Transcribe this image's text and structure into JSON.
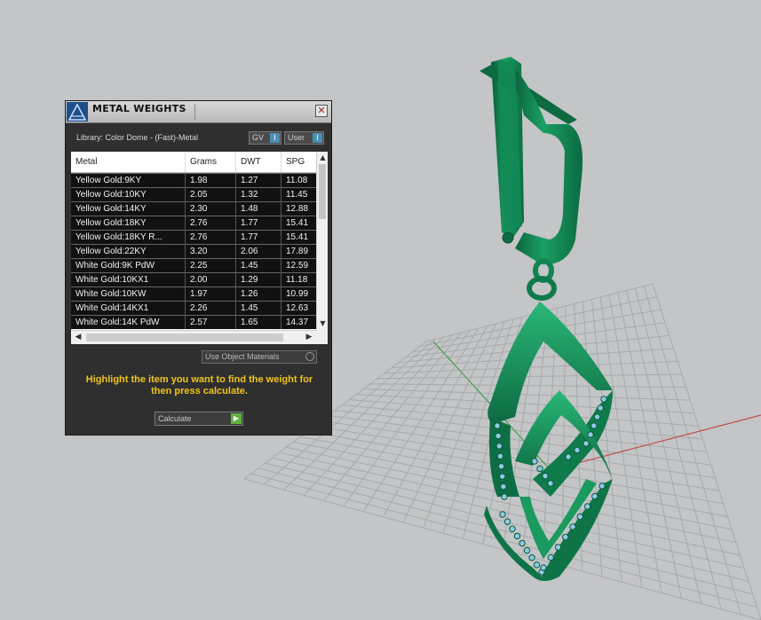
{
  "dialog": {
    "title": "METAL WEIGHTS",
    "close_label": "✕",
    "library": "Library: Color Dome - (Fast)-Metal",
    "toggles": [
      {
        "label": "GV",
        "knob": "I"
      },
      {
        "label": "User",
        "knob": "I"
      }
    ],
    "table": {
      "columns": [
        "Metal",
        "Grams",
        "DWT",
        "SPG"
      ],
      "rows": [
        [
          "Yellow Gold:9KY",
          "1.98",
          "1.27",
          "11.08"
        ],
        [
          "Yellow Gold:10KY",
          "2.05",
          "1.32",
          "11.45"
        ],
        [
          "Yellow Gold:14KY",
          "2.30",
          "1.48",
          "12.88"
        ],
        [
          "Yellow Gold:18KY",
          "2.76",
          "1.77",
          "15.41"
        ],
        [
          "Yellow Gold:18KY R...",
          "2.76",
          "1.77",
          "15.41"
        ],
        [
          "Yellow Gold:22KY",
          "3.20",
          "2.06",
          "17.89"
        ],
        [
          "White Gold:9K PdW",
          "2.25",
          "1.45",
          "12.59"
        ],
        [
          "White Gold:10KX1",
          "2.00",
          "1.29",
          "11.18"
        ],
        [
          "White Gold:10KW",
          "1.97",
          "1.26",
          "10.99"
        ],
        [
          "White Gold:14KX1",
          "2.26",
          "1.45",
          "12.63"
        ],
        [
          "White Gold:14K PdW",
          "2.57",
          "1.65",
          "14.37"
        ]
      ]
    },
    "use_object_materials": "Use Object Materials",
    "instruction": "Highlight the item you want to find the weight for then press calculate.",
    "calculate_label": "Calculate"
  },
  "colors": {
    "viewport_bg": "#c3c5c7",
    "grid": "#a9abad",
    "model_green": "#0f7a4a",
    "gems": "#8ec8e8",
    "accent_yellow": "#f2c41a"
  }
}
